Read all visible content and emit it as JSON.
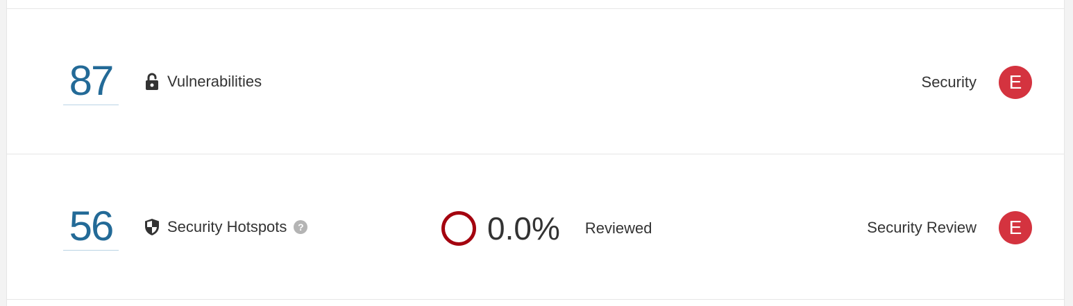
{
  "vulnerabilities": {
    "count": "87",
    "label": "Vulnerabilities",
    "icon": "unlock-icon",
    "rating_label": "Security",
    "rating": "E",
    "rating_color": "#d4333f"
  },
  "hotspots": {
    "count": "56",
    "label": "Security Hotspots",
    "icon": "shield-icon",
    "help": "?",
    "reviewed_percent": "0.0%",
    "reviewed_label": "Reviewed",
    "reviewed_fraction": 0.0,
    "rating_label": "Security Review",
    "rating": "E",
    "rating_color": "#d4333f"
  },
  "colors": {
    "accent": "#236a97",
    "rating_e": "#d4333f",
    "review_ring": "#a4030f"
  }
}
